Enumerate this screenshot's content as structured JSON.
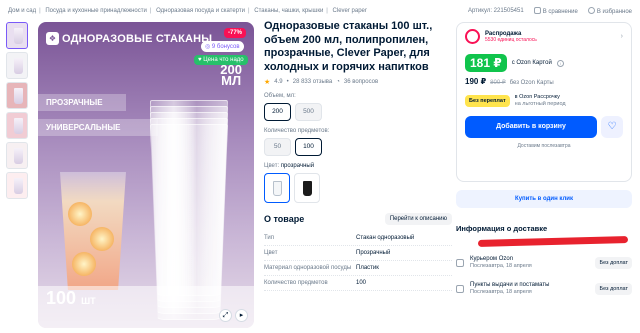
{
  "breadcrumb": [
    "Дом и сад",
    "Посуда и кухонные принадлежности",
    "Одноразовая посуда и скатерти",
    "Стаканы, чашки, крышки",
    "Clever paper"
  ],
  "topbar": {
    "article": "Артикул: 221505451",
    "compare": "В сравнение",
    "favorite": "В избранное"
  },
  "hero": {
    "title": "ОДНОРАЗОВЫЕ СТАКАНЫ",
    "discount": "-77%",
    "bonus": "9 бонусов",
    "price_tag": "Цена что надо",
    "volume_num": "200",
    "volume_unit": "МЛ",
    "tag1": "ПРОЗРАЧНЫЕ",
    "tag2": "УНИВЕРСАЛЬНЫЕ",
    "count_num": "100",
    "count_unit": "ШТ"
  },
  "product": {
    "title": "Одноразовые стаканы 100 шт., объем 200 мл, полипропилен, прозрачные, Clever Paper, для холодных и горячих напитков",
    "rating": "4.9",
    "reviews": "28 833 отзыва",
    "questions": "36 вопросов",
    "volume_label": "Объем, мл:",
    "volume_options": [
      "200",
      "500"
    ],
    "qty_label": "Количество предметов:",
    "qty_options": [
      "50",
      "100"
    ],
    "color_label": "Цвет:",
    "color_value": "прозрачный"
  },
  "about": {
    "title": "О товаре",
    "more": "Перейти к описанию",
    "props": [
      {
        "k": "Тип",
        "v": "Стакан одноразовый"
      },
      {
        "k": "Цвет",
        "v": "Прозрачный"
      },
      {
        "k": "Материал одноразовой посуды",
        "v": "Пластик"
      },
      {
        "k": "Количество предметов",
        "v": "100"
      }
    ]
  },
  "buy": {
    "sale_title": "Распродажа",
    "sale_sub": "5530 единиц осталось",
    "price_card": "181 ₽",
    "card_text": "c Ozon Картой",
    "price": "190 ₽",
    "old_price": "800 ₽",
    "no_card": "без Ozon Карты",
    "credit_badge": "Без переплат",
    "credit_text": "в Ozon Рассрочку",
    "credit_sub": "на льготный период",
    "cart": "Добавить в корзину",
    "delivery_note": "Доставим послезавтра",
    "one_click": "Купить в один клик"
  },
  "delivery": {
    "title": "Информация о доставке",
    "options": [
      {
        "name": "Курьером Ozon",
        "when": "Послезавтра, 18 апреля",
        "price": "Без доплат"
      },
      {
        "name": "Пункты выдачи и постаматы",
        "when": "Послезавтра, 18 апреля",
        "price": "Без доплат"
      }
    ]
  },
  "colors": {
    "accent": "#005bff",
    "green": "#10c44c",
    "discount": "#f91155",
    "hero": "#7a5496"
  }
}
